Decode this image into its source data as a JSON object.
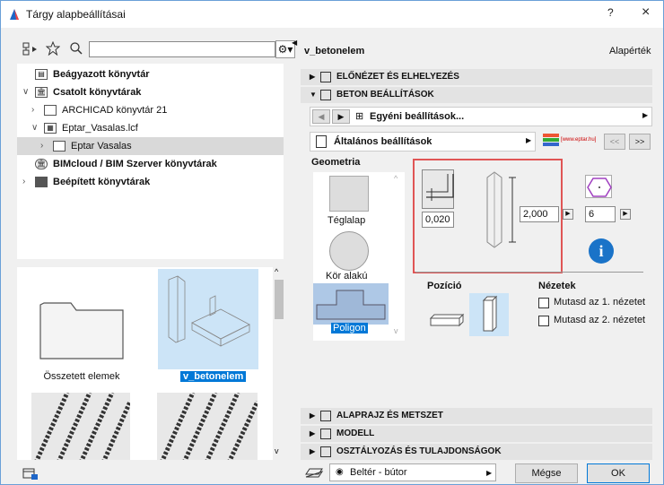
{
  "window": {
    "title": "Tárgy alapbeállításai",
    "help_label": "?",
    "close_label": "×"
  },
  "library_tree": {
    "items": [
      {
        "label": "Beágyazott könyvtár",
        "bold": true
      },
      {
        "label": "Csatolt könyvtárak",
        "bold": true
      },
      {
        "label": "ARCHICAD könyvtár 21",
        "bold": false
      },
      {
        "label": "Eptar_Vasalas.lcf",
        "bold": false
      },
      {
        "label": "Eptar Vasalas",
        "bold": false
      },
      {
        "label": "BIMcloud / BIM Szerver könyvtárak",
        "bold": true
      },
      {
        "label": "Beépített könyvtárak",
        "bold": true
      }
    ]
  },
  "thumbnails": {
    "items": [
      {
        "label": "Összetett elemek"
      },
      {
        "label": "v_betonelem"
      }
    ]
  },
  "object": {
    "name": "v_betonelem",
    "default_label": "Alapérték"
  },
  "sections": {
    "preview": "ELŐNÉZET ÉS ELHELYEZÉS",
    "concrete": "BETON BEÁLLÍTÁSOK",
    "floorplan": "ALAPRAJZ ÉS METSZET",
    "model": "MODELL",
    "classification": "OSZTÁLYOZÁS ÉS TULAJDONSÁGOK"
  },
  "settings": {
    "custom_label": "Egyéni beállítások...",
    "general_label": "Általános beállítások",
    "prev_label": "<<",
    "next_label": ">>",
    "eptar_label": "[www.eptar.hu]"
  },
  "geometry": {
    "heading": "Geometria",
    "shapes": [
      {
        "label": "Téglalap"
      },
      {
        "label": "Kör alakú"
      },
      {
        "label": "Poligon"
      }
    ],
    "offset_value": "0,020",
    "height_value": "2,000",
    "sides_value": "6"
  },
  "position": {
    "heading": "Pozíció"
  },
  "views": {
    "heading": "Nézetek",
    "show_view1": "Mutasd az 1. nézetet",
    "show_view2": "Mutasd az 2. nézetet"
  },
  "footer": {
    "layer_label": "Beltér - bútor",
    "cancel_label": "Mégse",
    "ok_label": "OK"
  },
  "colors": {
    "accent": "#0078d7",
    "selection": "#cce4f7",
    "highlight_box": "#e05555"
  }
}
